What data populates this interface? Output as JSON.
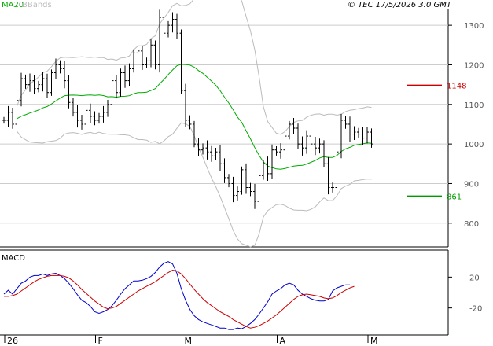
{
  "header": {
    "legend_ma": "MA20",
    "legend_bb": "BBands",
    "copyright": "© TEC 17/5/2026 3:0 GMT"
  },
  "macd_label": "MACD",
  "colors": {
    "price": "#000000",
    "ma": "#00aa00",
    "bbands": "#bbbbbb",
    "resistance": "#cc0000",
    "support": "#009900",
    "macd": "#0000cc",
    "signal": "#cc0000",
    "grid": "#cccccc"
  },
  "chart_data": [
    {
      "type": "bar",
      "subtype": "ohlc-price",
      "x_ticks": [
        {
          "label": "26",
          "i": 0
        },
        {
          "label": "F",
          "i": 21
        },
        {
          "label": "M",
          "i": 41
        },
        {
          "label": "A",
          "i": 63
        },
        {
          "label": "M",
          "i": 84
        }
      ],
      "y_ticks": [
        800,
        900,
        1000,
        1100,
        1200,
        1300
      ],
      "ylim": [
        740,
        1340
      ],
      "n_bars": 93,
      "i_offset": -16,
      "grid": true,
      "levels": [
        {
          "label": "1148",
          "value": 1148,
          "color": "#cc0000"
        },
        {
          "label": "861",
          "value": 868,
          "color": "#009900"
        }
      ],
      "close": [
        1060,
        1080,
        1050,
        1110,
        1165,
        1150,
        1160,
        1140,
        1150,
        1165,
        1130,
        1180,
        1200,
        1190,
        1160,
        1105,
        1080,
        1060,
        1050,
        1085,
        1070,
        1060,
        1070,
        1080,
        1100,
        1160,
        1130,
        1180,
        1160,
        1190,
        1230,
        1235,
        1200,
        1210,
        1250,
        1200,
        1320,
        1280,
        1300,
        1315,
        1280,
        1135,
        1060,
        1050,
        1000,
        985,
        990,
        980,
        970,
        980,
        950,
        915,
        900,
        870,
        880,
        935,
        890,
        880,
        855,
        920,
        950,
        925,
        985,
        980,
        985,
        1020,
        1050,
        1040,
        1000,
        990,
        1020,
        1000,
        990,
        1000,
        950,
        890,
        890,
        980,
        1060,
        1050,
        1025,
        1030,
        1025,
        1015,
        1030,
        1000
      ]
    },
    {
      "type": "line",
      "subtype": "macd",
      "y_ticks": [
        {
          "label": "20",
          "value": 20
        },
        {
          "label": "-20",
          "value": -20
        }
      ],
      "ylim": [
        -55,
        55
      ],
      "series": [
        {
          "role": "macd",
          "values": [
            -2,
            3,
            -2,
            5,
            12,
            15,
            20,
            22,
            22,
            24,
            22,
            24,
            25,
            22,
            18,
            12,
            5,
            -3,
            -10,
            -13,
            -18,
            -25,
            -27,
            -25,
            -22,
            -17,
            -10,
            -2,
            5,
            10,
            15,
            15,
            16,
            18,
            21,
            26,
            33,
            38,
            40,
            37,
            25,
            5,
            -10,
            -22,
            -30,
            -35,
            -38,
            -40,
            -42,
            -44,
            -46,
            -46,
            -48,
            -48,
            -46,
            -47,
            -44,
            -40,
            -35,
            -28,
            -20,
            -12,
            -2,
            2,
            5,
            10,
            12,
            10,
            3,
            -2,
            -5,
            -8,
            -10,
            -11,
            -11,
            -9,
            2,
            6,
            8,
            10,
            10
          ]
        },
        {
          "role": "signal",
          "values": [
            -5,
            -5,
            -4,
            -2,
            2,
            6,
            10,
            14,
            17,
            19,
            21,
            22,
            22,
            22,
            21,
            19,
            15,
            10,
            4,
            -1,
            -6,
            -11,
            -15,
            -19,
            -21,
            -20,
            -18,
            -14,
            -10,
            -6,
            -2,
            2,
            5,
            8,
            11,
            14,
            18,
            22,
            26,
            29,
            28,
            24,
            18,
            11,
            4,
            -2,
            -8,
            -13,
            -17,
            -21,
            -25,
            -28,
            -31,
            -35,
            -38,
            -41,
            -44,
            -46,
            -45,
            -43,
            -40,
            -37,
            -33,
            -29,
            -24,
            -19,
            -14,
            -9,
            -5,
            -3,
            -2,
            -3,
            -4,
            -5,
            -7,
            -8,
            -7,
            -4,
            0,
            3,
            6,
            8
          ]
        }
      ]
    }
  ]
}
